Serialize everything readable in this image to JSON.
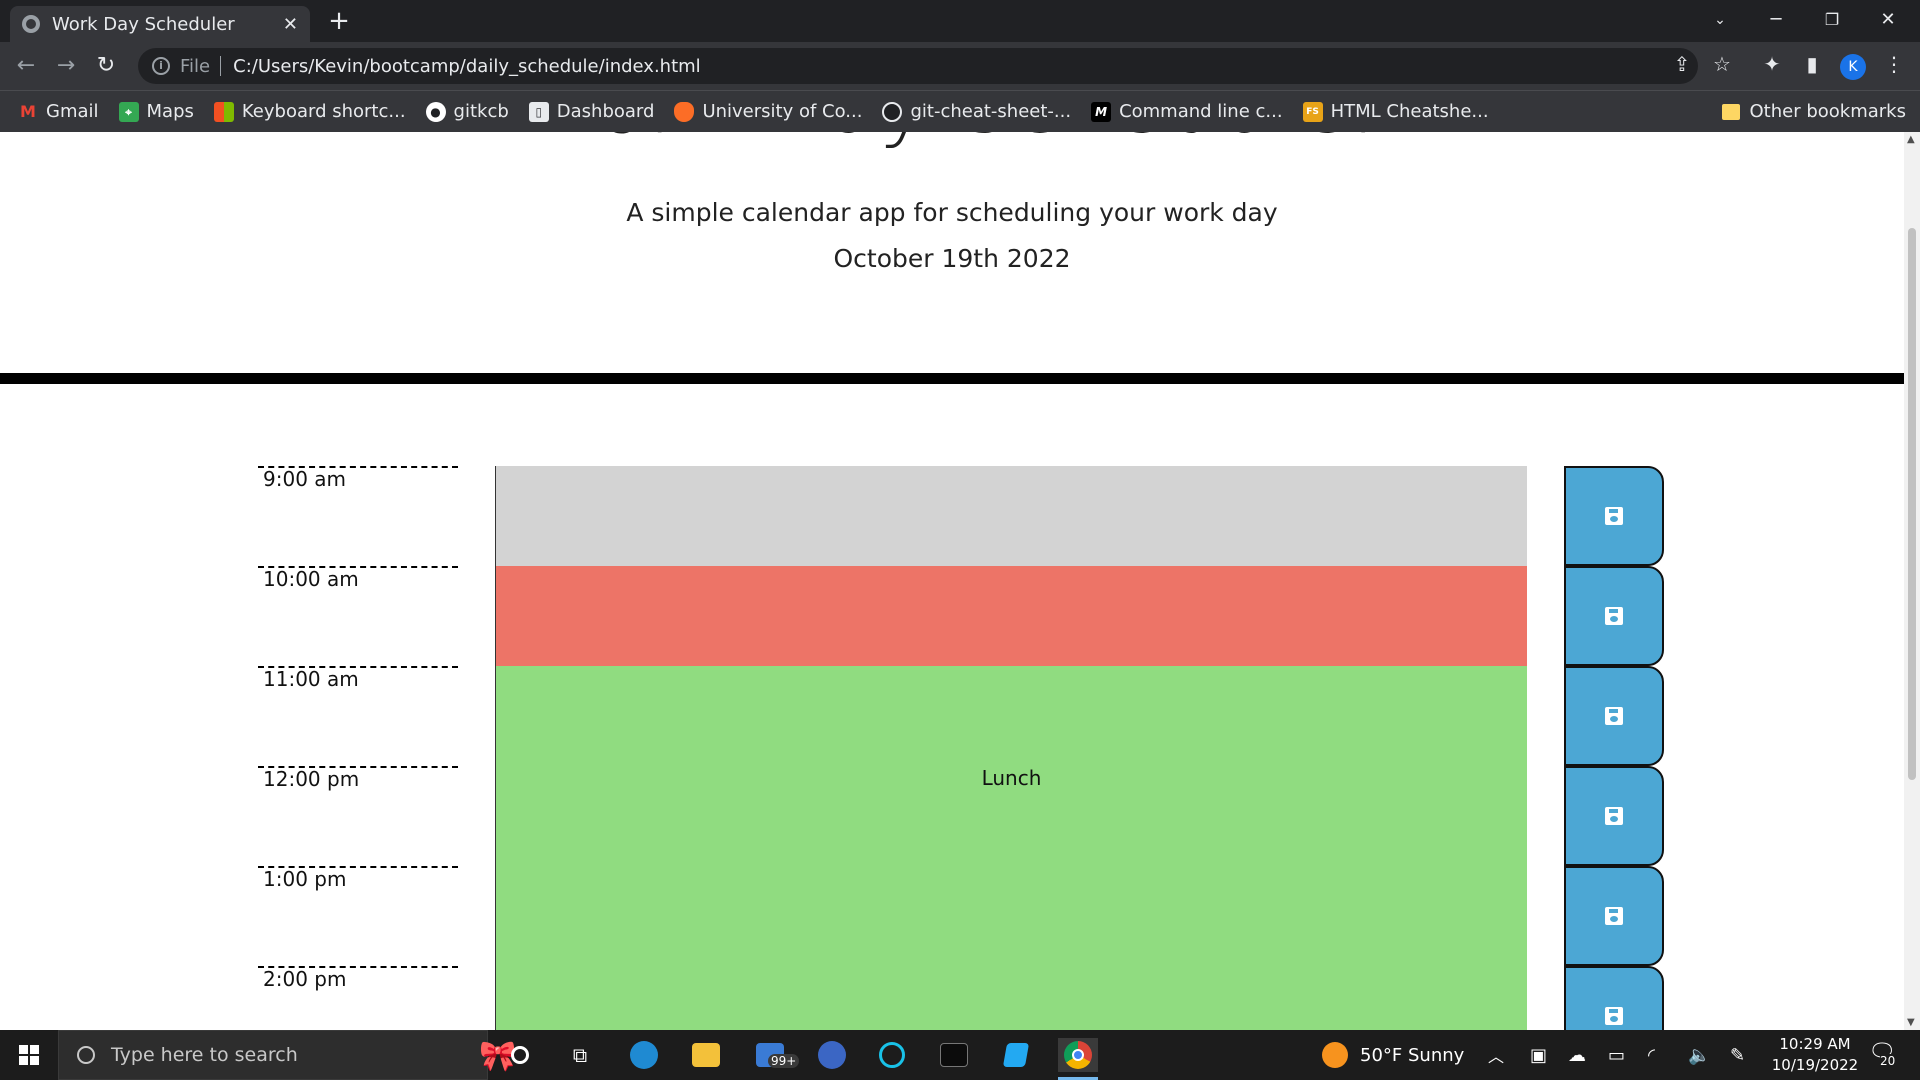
{
  "browser": {
    "tab_title": "Work Day Scheduler",
    "tab_close": "✕",
    "new_tab": "+",
    "url_scheme": "File",
    "url_path": "C:/Users/Kevin/bootcamp/daily_schedule/index.html",
    "profile_initial": "K",
    "bookmarks": [
      {
        "label": "Gmail",
        "icon": "gmail-icon",
        "color": "#ea4335",
        "glyph": "M"
      },
      {
        "label": "Maps",
        "icon": "maps-icon",
        "color": "#34a853",
        "glyph": "⌖"
      },
      {
        "label": "Keyboard shortc...",
        "icon": "microsoft-icon",
        "color": "#f25022",
        "glyph": "▦"
      },
      {
        "label": "gitkcb",
        "icon": "github-icon",
        "color": "#202124",
        "glyph": "●"
      },
      {
        "label": "Dashboard",
        "icon": "canvas-icon",
        "color": "#e8eaed",
        "glyph": "▯"
      },
      {
        "label": "University of Co...",
        "icon": "gitlab-icon",
        "color": "#fc6d26",
        "glyph": "◆"
      },
      {
        "label": "git-cheat-sheet-...",
        "icon": "github-icon",
        "color": "#202124",
        "glyph": "●"
      },
      {
        "label": "Command line c...",
        "icon": "medium-icon",
        "color": "#000000",
        "glyph": "M"
      },
      {
        "label": "HTML Cheatshe...",
        "icon": "fs-icon",
        "color": "#e8a317",
        "glyph": "FS"
      }
    ],
    "other_bookmarks": "Other bookmarks"
  },
  "page": {
    "title": "Work Day Scheduler",
    "lead": "A simple calendar app for scheduling your work day",
    "current_day": "October 19th 2022"
  },
  "time_blocks": [
    {
      "hour": "9:00 am",
      "description": "",
      "state": "past"
    },
    {
      "hour": "10:00 am",
      "description": "",
      "state": "present"
    },
    {
      "hour": "11:00 am",
      "description": "",
      "state": "future"
    },
    {
      "hour": "12:00 pm",
      "description": "Lunch",
      "state": "future"
    },
    {
      "hour": "1:00 pm",
      "description": "",
      "state": "future"
    },
    {
      "hour": "2:00 pm",
      "description": "",
      "state": "future"
    }
  ],
  "colors": {
    "past": "#d3d3d3",
    "present": "#ed7467",
    "future": "#90dc80",
    "save_button": "#4ca7d4"
  },
  "taskbar": {
    "search_placeholder": "Type here to search",
    "mail_badge": "99+",
    "weather": "50°F  Sunny",
    "time": "10:29 AM",
    "date": "10/19/2022",
    "notification_count": "20"
  }
}
